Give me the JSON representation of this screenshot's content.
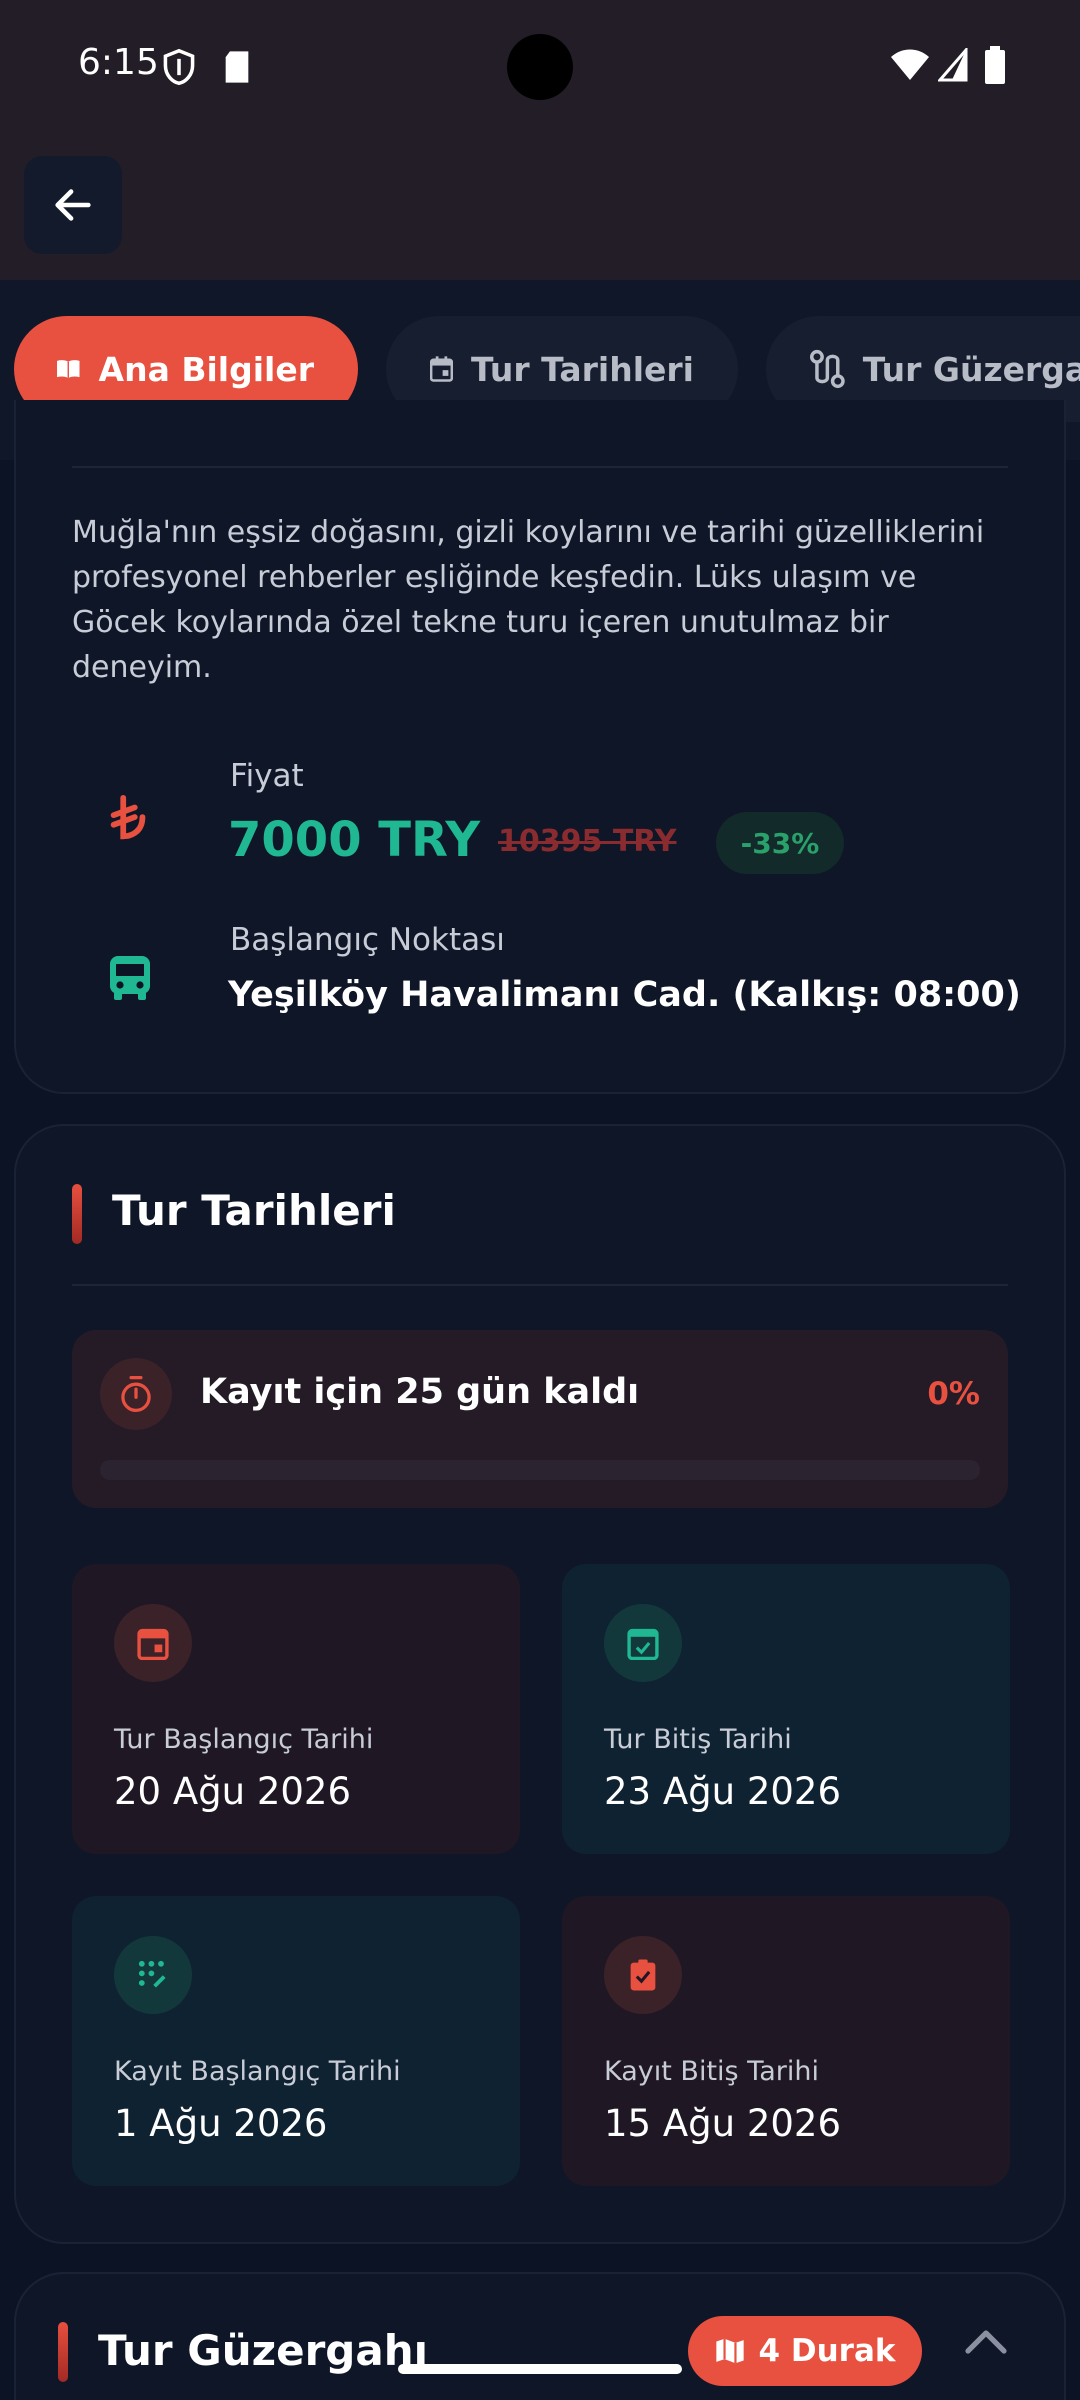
{
  "status_bar": {
    "time": "6:15",
    "icons": [
      "shield-icon",
      "sd-card-icon",
      "wifi-icon",
      "signal-icon",
      "battery-icon"
    ]
  },
  "app_bar": {
    "back_icon": "arrow-left-icon"
  },
  "tabs": [
    {
      "label": "Ana Bilgiler",
      "icon": "book-open-icon",
      "active": true
    },
    {
      "label": "Tur Tarihleri",
      "icon": "calendar-icon",
      "active": false
    },
    {
      "label": "Tur Güzergahı",
      "icon": "route-icon",
      "active": false
    }
  ],
  "info": {
    "description": "Muğla'nın eşsiz doğasını, gizli koylarını ve tarihi güzelliklerini profesyonel rehberler eşliğinde keşfedin. Lüks ulaşım ve Göcek koylarında özel tekne turu içeren unutulmaz bir deneyim.",
    "price_label": "Fiyat",
    "price": "7000 TRY",
    "old_price": "10395 TRY",
    "discount": "-33%",
    "start_label": "Başlangıç Noktası",
    "start_value": "Yeşilköy Havalimanı Cad. (Kalkış: 08:00)"
  },
  "dates_section": {
    "title": "Tur Tarihleri",
    "countdown_text": "Kayıt için 25 gün kaldı",
    "countdown_percent": "0%",
    "progress": 0,
    "cards": [
      {
        "label": "Tur Başlangıç Tarihi",
        "value": "20 Ağu 2026",
        "icon": "calendar-icon"
      },
      {
        "label": "Tur Bitiş Tarihi",
        "value": "23 Ağu 2026",
        "icon": "calendar-check-icon"
      },
      {
        "label": "Kayıt Başlangıç Tarihi",
        "value": "1 Ağu 2026",
        "icon": "dialpad-icon"
      },
      {
        "label": "Kayıt Bitiş Tarihi",
        "value": "15 Ağu 2026",
        "icon": "clipboard-check-icon"
      }
    ]
  },
  "route_section": {
    "title": "Tur Güzergahı",
    "stops_button": "4 Durak"
  },
  "colors": {
    "accent": "#e8503f",
    "teal": "#1fb893",
    "background": "#0c1324"
  }
}
